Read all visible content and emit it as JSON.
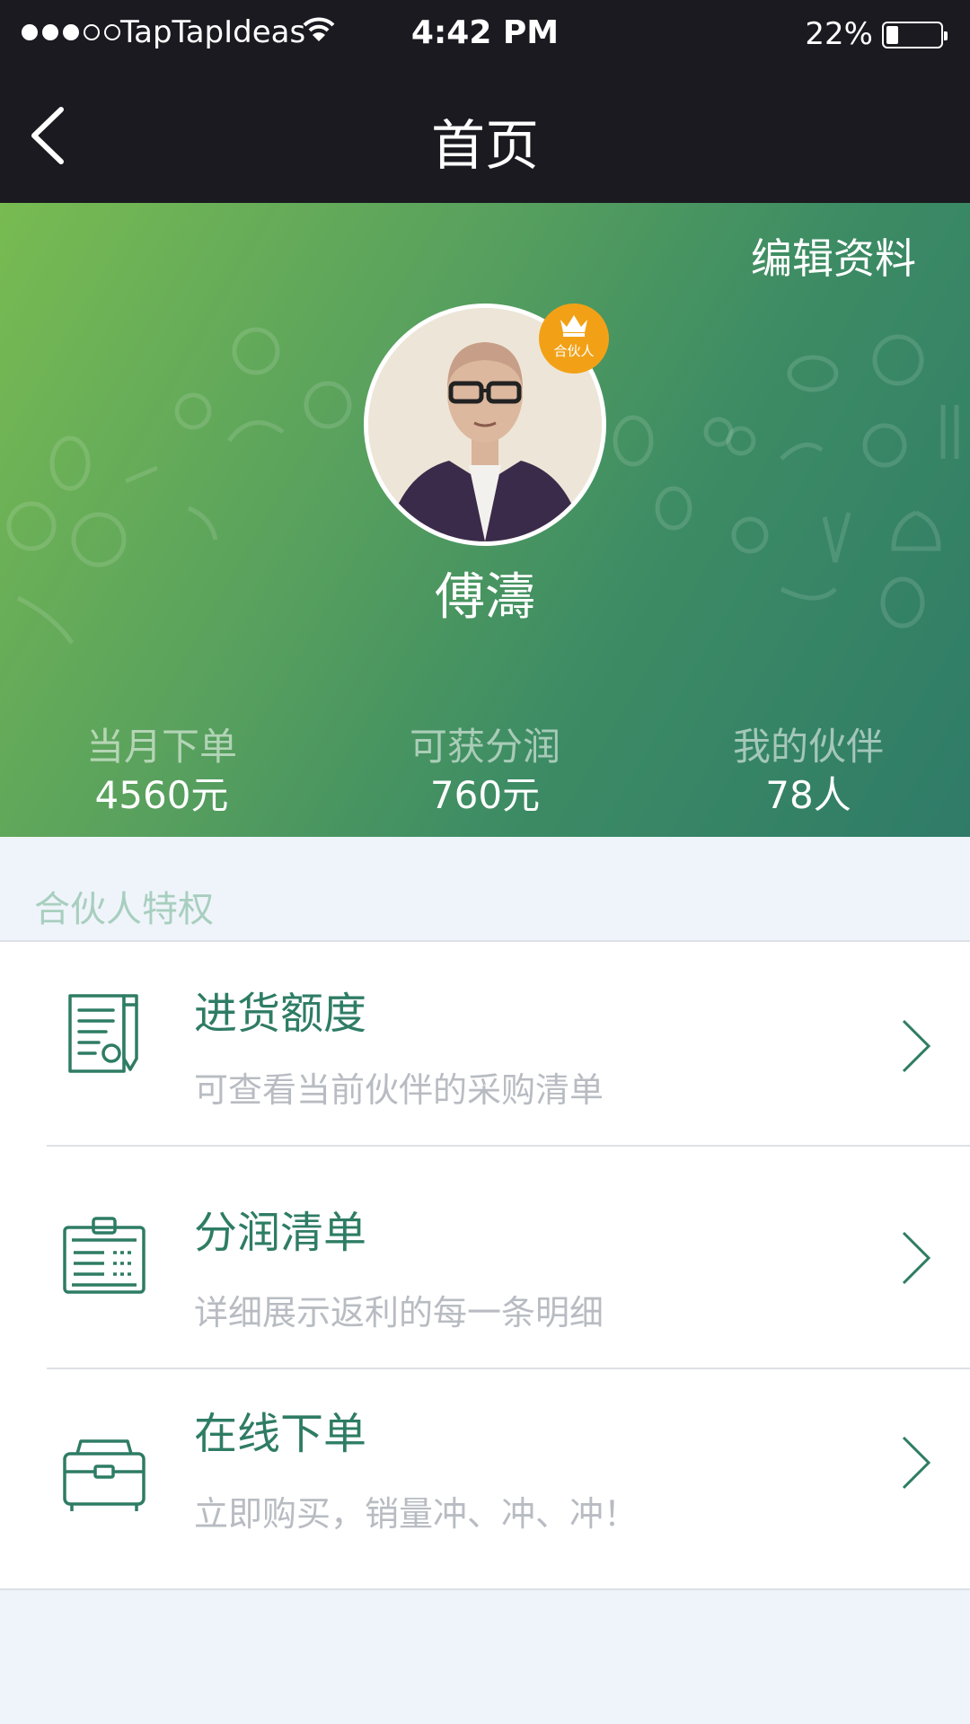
{
  "status_bar": {
    "carrier": "TapTapIdeas",
    "time": "4:42 PM",
    "battery": "22%",
    "battery_level": 0.22
  },
  "nav": {
    "title": "首页"
  },
  "profile": {
    "edit_label": "编辑资料",
    "badge_label": "合伙人",
    "name": "傅濤",
    "stats": [
      {
        "label": "当月下单",
        "value": "4560元"
      },
      {
        "label": "可获分润",
        "value": "760元"
      },
      {
        "label": "我的伙伴",
        "value": "78人"
      }
    ]
  },
  "section": {
    "title": "合伙人特权"
  },
  "menu": {
    "items": [
      {
        "title": "进货额度",
        "subtitle": "可查看当前伙伴的采购清单",
        "icon": "document-pen-icon"
      },
      {
        "title": "分润清单",
        "subtitle": "详细展示返利的每一条明细",
        "icon": "clipboard-list-icon"
      },
      {
        "title": "在线下单",
        "subtitle": "立即购买，销量冲、冲、冲！",
        "icon": "toolbox-icon"
      }
    ]
  },
  "colors": {
    "accent": "#2e7c64",
    "badge": "#f2a117",
    "bar_bg": "#1b1a20"
  }
}
